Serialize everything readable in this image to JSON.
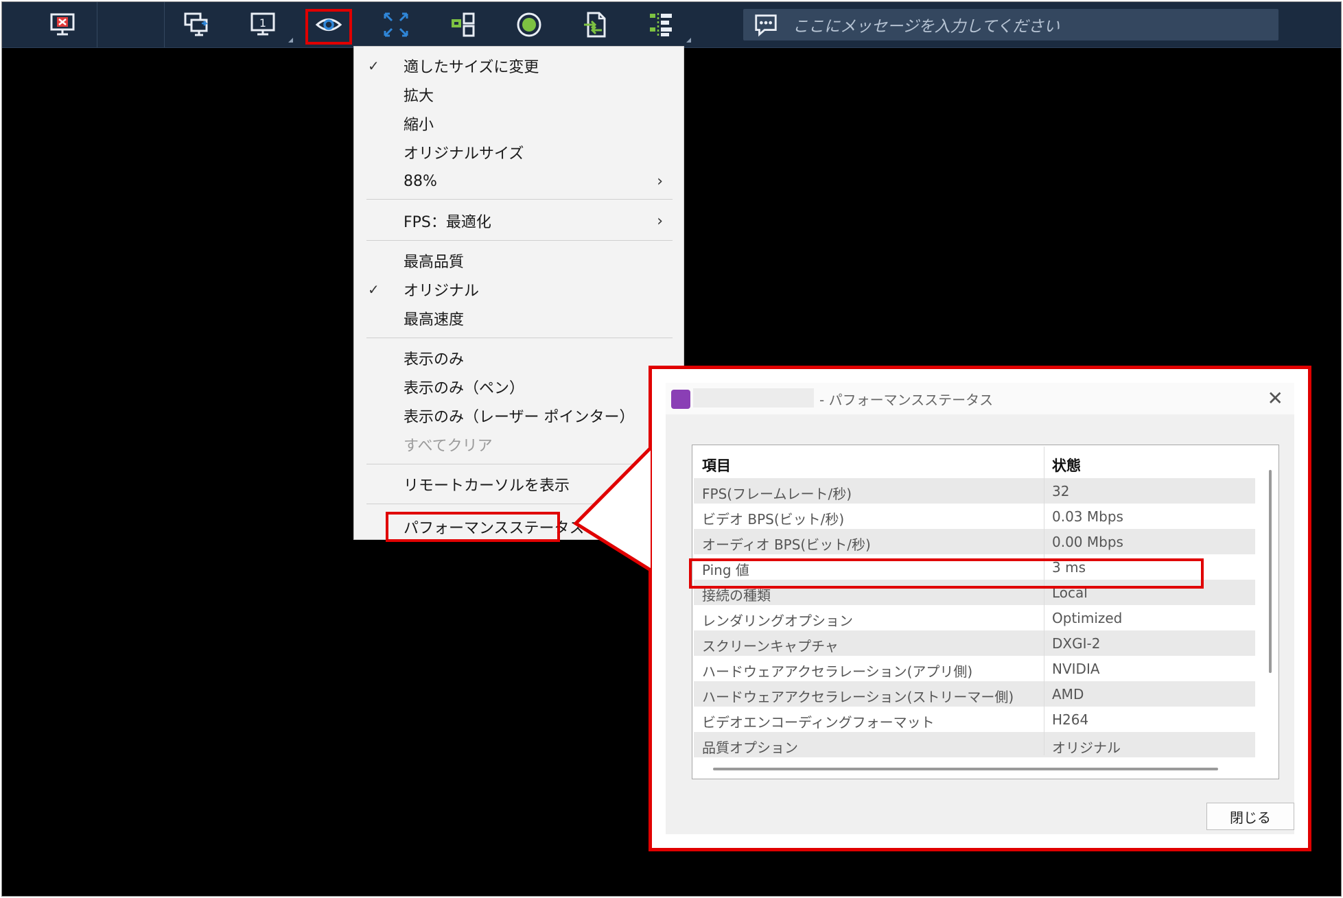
{
  "toolbar": {
    "buttons": [
      {
        "name": "disconnect-icon"
      },
      {
        "name": "switch-monitor-icon"
      },
      {
        "name": "monitor-1-icon",
        "label": "1"
      },
      {
        "name": "view-eye-icon"
      },
      {
        "name": "fullscreen-icon"
      },
      {
        "name": "remote-control-icon"
      },
      {
        "name": "record-icon"
      },
      {
        "name": "file-transfer-icon"
      },
      {
        "name": "settings-list-icon"
      }
    ],
    "message_placeholder": "ここにメッセージを入力してください",
    "colors": {
      "bar": "#1b2b40",
      "icon_white": "#e9eef5",
      "icon_blue": "#2f86d8",
      "icon_green": "#7dc242"
    }
  },
  "menu": {
    "items": [
      {
        "label": "適したサイズに変更",
        "checked": true
      },
      {
        "label": "拡大"
      },
      {
        "label": "縮小"
      },
      {
        "label": "オリジナルサイズ"
      },
      {
        "label": "88%",
        "submenu": true
      },
      {
        "label": "FPS：最適化",
        "submenu": true
      },
      {
        "label": "最高品質"
      },
      {
        "label": "オリジナル",
        "checked": true
      },
      {
        "label": "最高速度"
      },
      {
        "label": "表示のみ"
      },
      {
        "label": "表示のみ（ペン）"
      },
      {
        "label": "表示のみ（レーザー ポインター）"
      },
      {
        "label": "すべてクリア",
        "disabled": true
      },
      {
        "label": "リモートカーソルを表示"
      },
      {
        "label": "パフォーマンスステータス"
      }
    ],
    "check_glyph": "✓",
    "arrow_glyph": "›"
  },
  "dialog": {
    "title": "- パフォーマンスステータス",
    "close_glyph": "✕",
    "headers": {
      "item": "項目",
      "status": "状態"
    },
    "rows": [
      {
        "item": "FPS(フレームレート/秒)",
        "status": "32"
      },
      {
        "item": "ビデオ BPS(ビット/秒)",
        "status": "0.03 Mbps"
      },
      {
        "item": "オーディオ BPS(ビット/秒)",
        "status": "0.00 Mbps"
      },
      {
        "item": "Ping 値",
        "status": "3 ms"
      },
      {
        "item": "接続の種類",
        "status": "Local"
      },
      {
        "item": "レンダリングオプション",
        "status": "Optimized"
      },
      {
        "item": "スクリーンキャプチャ",
        "status": "DXGI-2"
      },
      {
        "item": "ハードウェアアクセラレーション(アプリ側)",
        "status": "NVIDIA"
      },
      {
        "item": "ハードウェアアクセラレーション(ストリーマー側)",
        "status": "AMD"
      },
      {
        "item": "ビデオエンコーディングフォーマット",
        "status": "H264"
      },
      {
        "item": "品質オプション",
        "status": "オリジナル"
      }
    ],
    "close_button": "閉じる",
    "highlight_color": "#e00000"
  }
}
